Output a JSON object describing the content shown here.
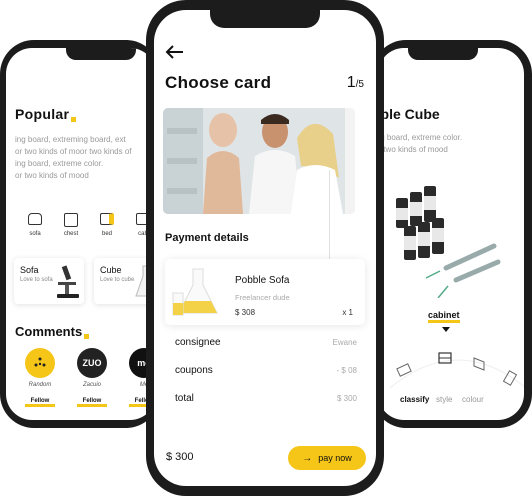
{
  "left_screen": {
    "title": "Popular",
    "desc_1": "ing board, extreming board, ext",
    "desc_2": "or two kinds of moor two kinds of",
    "desc_3": "ing board, extreme color.",
    "desc_4": "or two kinds of mood",
    "categories": [
      {
        "label": "sofa",
        "icon": "sofa-icon"
      },
      {
        "label": "chest",
        "icon": "chest-icon"
      },
      {
        "label": "bed",
        "icon": "bed-icon"
      },
      {
        "label": "cab",
        "icon": "cabinet-icon"
      }
    ],
    "cards": [
      {
        "title": "Sofa",
        "subtitle": "Love to sofa"
      },
      {
        "title": "Cube",
        "subtitle": "Love to cube"
      }
    ],
    "comments_title": "Comments",
    "people": [
      {
        "name": "Random",
        "avatar_text": "",
        "avatar_color": "#f5c518",
        "follow_label": "Fellow"
      },
      {
        "name": "Zacuio",
        "avatar_text": "ZUO",
        "avatar_color": "#222222",
        "follow_label": "Fellow"
      },
      {
        "name": "Me",
        "avatar_text": "mo",
        "avatar_color": "#111111",
        "follow_label": "Fellow"
      }
    ]
  },
  "center_screen": {
    "back_icon": "arrow-left-icon",
    "title": "Choose card",
    "page_current": "1",
    "page_total": "/5",
    "section_title": "Payment details",
    "product": {
      "name": "Pobble Sofa",
      "seller": "Freelancer dude",
      "price": "$ 308",
      "quantity": "x 1"
    },
    "summary": [
      {
        "label": "consignee",
        "value": "Ewane"
      },
      {
        "label": "coupons",
        "value": "- $ 08"
      },
      {
        "label": "total",
        "value": "$ 300"
      }
    ],
    "footer_total": "$ 300",
    "pay_label": "pay now",
    "accent": "#f5c518"
  },
  "right_screen": {
    "title": "bble Cube",
    "desc_1": "ing board, extreme color.",
    "desc_2": "or two kinds of mood",
    "selected_category": "cabinet",
    "tabs": [
      {
        "label": "classify",
        "active": true
      },
      {
        "label": "style",
        "active": false
      },
      {
        "label": "colour",
        "active": false
      }
    ]
  }
}
